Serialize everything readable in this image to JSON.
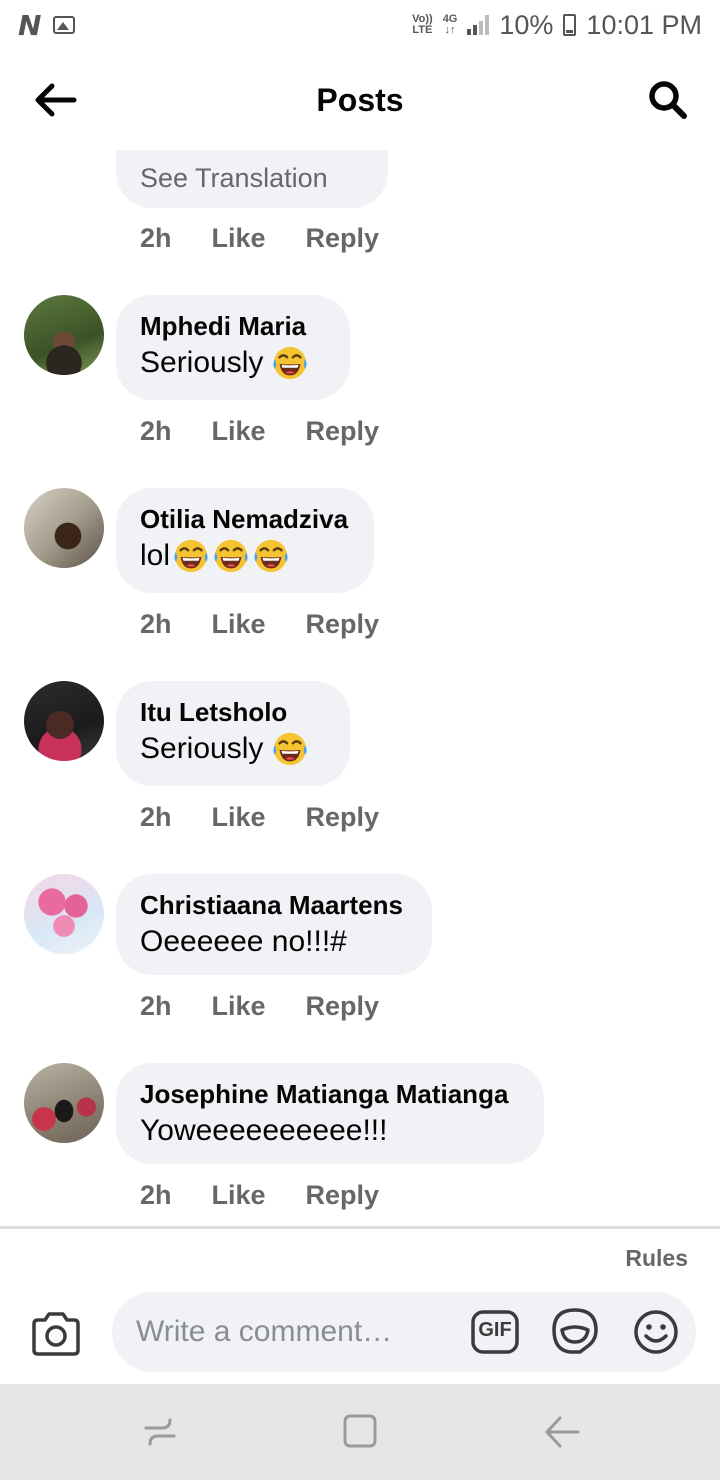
{
  "status_bar": {
    "volte_line1": "Vo))",
    "volte_line2": "LTE",
    "network": "4G",
    "network_arrows": "↓↑",
    "battery_pct": "10%",
    "time": "10:01 PM"
  },
  "header": {
    "title": "Posts"
  },
  "partial_comment": {
    "see_translation": "See Translation",
    "time": "2h",
    "like": "Like",
    "reply": "Reply"
  },
  "comments": [
    {
      "author": "Mphedi Maria",
      "text": "Seriously",
      "emojis": 1,
      "time": "2h",
      "like": "Like",
      "reply": "Reply"
    },
    {
      "author": "Otilia Nemadziva",
      "text": "lol",
      "emojis": 3,
      "time": "2h",
      "like": "Like",
      "reply": "Reply"
    },
    {
      "author": "Itu Letsholo",
      "text": "Seriously",
      "emojis": 1,
      "time": "2h",
      "like": "Like",
      "reply": "Reply"
    },
    {
      "author": "Christiaana Maartens",
      "text": "Oeeeeee no!!!#",
      "emojis": 0,
      "time": "2h",
      "like": "Like",
      "reply": "Reply"
    },
    {
      "author": "Josephine Matianga Matianga",
      "text": "Yoweeeeeeeeee!!!",
      "emojis": 0,
      "time": "2h",
      "like": "Like",
      "reply": "Reply"
    }
  ],
  "composer": {
    "rules": "Rules",
    "placeholder": "Write a comment…",
    "gif_label": "GIF"
  },
  "colors": {
    "bubble": "#f0f2f5",
    "secondary_text": "#65676b",
    "nav_bar": "#e6e6e6"
  }
}
